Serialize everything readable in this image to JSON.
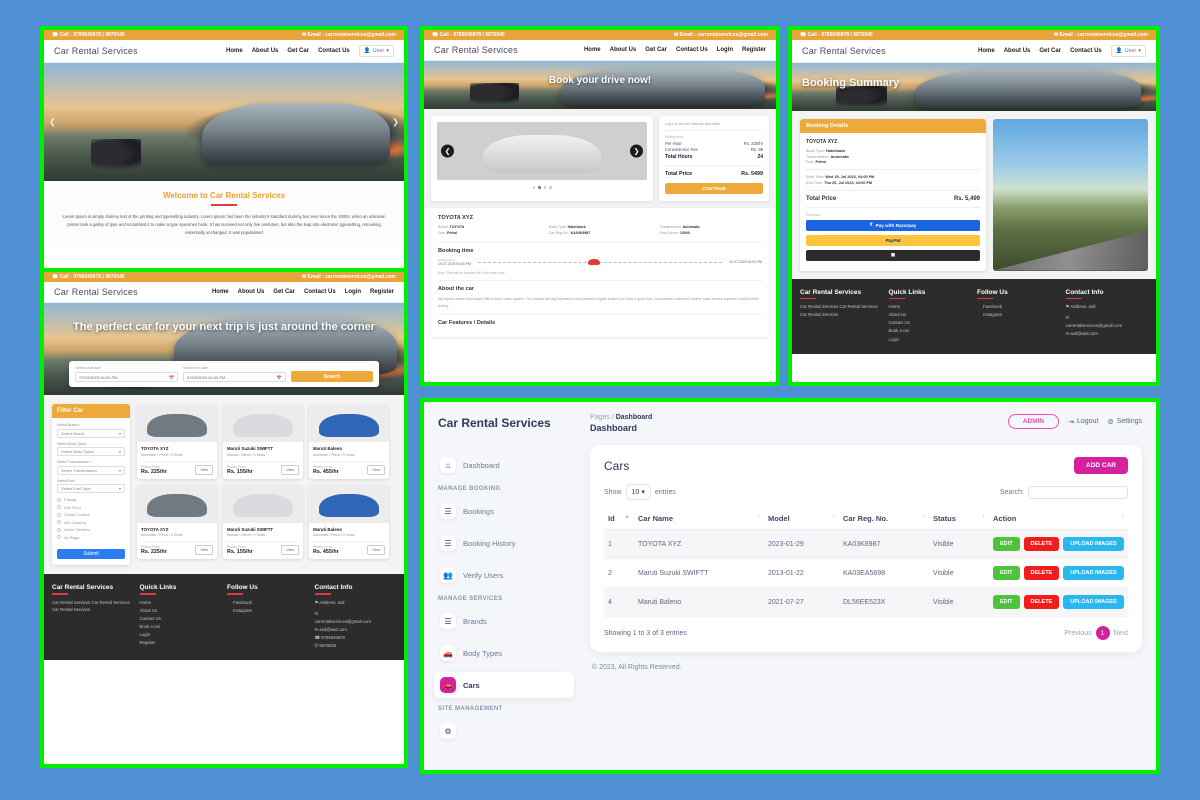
{
  "site": {
    "brand": "Car Rental Services",
    "topbar": {
      "phone": "☎ Call : 9786549878 | 9876545",
      "email": "✉ Email : carrentalservices@gmail.com"
    },
    "nav_user": [
      "Home",
      "About Us",
      "Get Car",
      "Contact Us"
    ],
    "nav_guest": [
      "Home",
      "About Us",
      "Get Car",
      "Contact Us",
      "Login",
      "Register"
    ],
    "user_menu": "User"
  },
  "home": {
    "hero_title": "",
    "welcome_title": "Welcome to Car Rental Services",
    "welcome_text": "Lorem Ipsum is simply dummy text of the printing and typesetting industry. Lorem Ipsum has been the industry's standard dummy text ever since the 1500s, when an unknown printer took a galley of type and scrambled it to make a type specimen book. It has survived not only five centuries, but also the leap into electronic typesetting, remaining essentially unchanged. It was popularised"
  },
  "search_page": {
    "hero_title": "The perfect car for your next trip is just around the corner",
    "start_label": "Select start date",
    "start_value": "07/19/2023 04:00 PM",
    "end_label": "Select end date",
    "end_value": "07/20/2023 04:00 PM",
    "search_button": "Search",
    "filter": {
      "title": "Filter Car",
      "selects": [
        {
          "label": "Select Brand *",
          "value": "Select Brand"
        },
        {
          "label": "Select Body Types",
          "value": "Select Body Types"
        },
        {
          "label": "Select Transmission *",
          "value": "Select Transmission"
        },
        {
          "label": "Select Fuel",
          "value": "Select Fuel Type"
        }
      ],
      "checkboxes": [
        "Fastag",
        "Sun Roof",
        "Cruise Control",
        "360 Camera",
        "Home Delivery",
        "Air Bags"
      ],
      "submit": "Submit"
    },
    "cars": [
      {
        "name": "TOYOTA XYZ",
        "spec": "Automatic • Petrol • 5 Seats",
        "from_label": "Pricing From",
        "price": "Rs. 225/hr",
        "view": "View",
        "color": "#6f7a82"
      },
      {
        "name": "Maruti Suzuki SWIFTT",
        "spec": "Manual • Diesel • 5 Seats",
        "from_label": "Pricing From",
        "price": "Rs. 155/hr",
        "view": "View",
        "color": "#d8dadd"
      },
      {
        "name": "Maruti Baleno",
        "spec": "Automatic • Petrol • 5 Seats",
        "from_label": "Pricing From",
        "price": "Rs. 455/hr",
        "view": "View",
        "color": "#2f66b5"
      },
      {
        "name": "TOYOTA XYZ",
        "spec": "Automatic • Petrol • 5 Seats",
        "from_label": "Pricing From",
        "price": "Rs. 225/hr",
        "view": "View",
        "color": "#6f7a82"
      },
      {
        "name": "Maruti Suzuki SWIFTT",
        "spec": "Manual • Diesel • 5 Seats",
        "from_label": "Pricing From",
        "price": "Rs. 155/hr",
        "view": "View",
        "color": "#d8dadd"
      },
      {
        "name": "Maruti Baleno",
        "spec": "Automatic • Petrol • 5 Seats",
        "from_label": "Pricing From",
        "price": "Rs. 455/hr",
        "view": "View",
        "color": "#2f66b5"
      }
    ]
  },
  "book_page": {
    "hero_title": "Book your drive now!",
    "pricing": {
      "note": "Log in to see the final fare and offers.",
      "from_label": "Pricing from",
      "rows": [
        {
          "label": "Per Hour",
          "value": "Rs. 225/hr"
        },
        {
          "label": "Convenience Fee",
          "value": "Rs. 99"
        }
      ],
      "hours_label": "Total Hours",
      "hours_value": "24",
      "total_label": "Total Price",
      "total_value": "Rs. 5499",
      "continue": "CONTINUE"
    },
    "car": {
      "name": "TOYOTA XYZ",
      "specs": [
        {
          "label": "Brand:",
          "value": "TOYOTA"
        },
        {
          "label": "Fuel:",
          "value": "Petrol"
        },
        {
          "label": "Body Type:",
          "value": "Hatchback"
        },
        {
          "label": "Car Reg.No.:",
          "value": "KA03K8987"
        },
        {
          "label": "Transmission:",
          "value": "Automatic"
        },
        {
          "label": "Kms Driven:",
          "value": "10000"
        }
      ]
    },
    "booking_time": {
      "title": "Booking time",
      "pickup_label": "Pickup Time",
      "start": "19-07-2023 04:00 PM",
      "end": "20-07-2023 04:00 PM",
      "note": "Note: Time will be rounded off to the lower hour"
    },
    "about": {
      "title": "About the car",
      "text": "My toyota comes fully loaded with a bose music system. The smooth driving Experience and powerful engine ensure you have a great ride. Comfortable cushioned leather seats ensure supreme comfort while driving.",
      "features_title": "Car Features / Details"
    }
  },
  "summary_page": {
    "hero_title": "Booking Summary",
    "details_head": "Booking Details",
    "car_name": "TOYOTA XYZ",
    "lines": [
      {
        "label": "Body Type:",
        "value": "Hatchback"
      },
      {
        "label": "Transmission:",
        "value": "Automatic"
      },
      {
        "label": "Fuel:",
        "value": "Petrol"
      }
    ],
    "times": [
      {
        "label": "Start Time:",
        "value": "Wed 19, Jul 2023, 04:00 PM"
      },
      {
        "label": "End Time:",
        "value": "Thu 20, Jul 2023, 04:00 PM"
      }
    ],
    "total_label": "Total Price",
    "total_value": "Rs. 5,499",
    "pay_now": "Pay now",
    "pay_razorpay": "Pay with Razorpay",
    "pay_paypal": "PayPal",
    "pay_card": "▤"
  },
  "footer": {
    "col1_title": "Car Rental Services",
    "col1_text": "Car Rental Services Car Rental Services Car Rental Services",
    "col2_title": "Quick Links",
    "links": [
      "Home",
      "About Us",
      "Contact Us",
      "Book a car",
      "Login",
      "Register"
    ],
    "col3_title": "Follow Us",
    "social": [
      "Facebook",
      "Instagram"
    ],
    "col4_title": "Contact Info",
    "address": "⚑ Address: asd",
    "email1": "carrentalservices@gmail.com",
    "email2": "asd@asd.com",
    "phone1": "☎ 9786549878",
    "phone2": "✆ 9876545"
  },
  "dashboard": {
    "brand": "Car Rental Services",
    "breadcrumb_pages": "Pages",
    "breadcrumb_sep": "/",
    "breadcrumb_current": "Dashboard",
    "page_title": "Dashboard",
    "admin_badge": "ADMIN",
    "logout": "Logout",
    "settings": "Settings",
    "sidebar": [
      {
        "type": "item",
        "label": "Dashboard",
        "icon": "home-icon",
        "glyph": "⌂",
        "active": false
      },
      {
        "type": "cat",
        "label": "MANAGE BOOKING"
      },
      {
        "type": "item",
        "label": "Bookings",
        "icon": "list-icon",
        "glyph": "☰",
        "active": false
      },
      {
        "type": "item",
        "label": "Booking History",
        "icon": "list-icon",
        "glyph": "☰",
        "active": false
      },
      {
        "type": "item",
        "label": "Verify Users",
        "icon": "users-icon",
        "glyph": "♟",
        "active": false
      },
      {
        "type": "cat",
        "label": "MANAGE SERVICES"
      },
      {
        "type": "item",
        "label": "Brands",
        "icon": "list-icon",
        "glyph": "☰",
        "active": false
      },
      {
        "type": "item",
        "label": "Body Types",
        "icon": "car-icon",
        "glyph": "⛟",
        "active": false
      },
      {
        "type": "item",
        "label": "Cars",
        "icon": "car-icon",
        "glyph": "⛟",
        "active": true
      },
      {
        "type": "cat",
        "label": "SITE MANAGEMENT"
      }
    ],
    "card_title": "Cars",
    "add_car": "ADD CAR",
    "show_label": "Show",
    "show_value": "10",
    "entries_label": "entries",
    "search_label": "Search:",
    "search_value": "",
    "columns": [
      "Id",
      "Car Name",
      "Model",
      "Car Reg. No.",
      "Status",
      "Action",
      ""
    ],
    "rows": [
      {
        "id": "1",
        "name": "TOYOTA XYZ",
        "model": "2023-01-29",
        "reg": "KA03K8987",
        "status": "Visible"
      },
      {
        "id": "2",
        "name": "Maruti Suzuki SWIFTT",
        "model": "2013-01-22",
        "reg": "KA03EA5698",
        "status": "Visible"
      },
      {
        "id": "4",
        "name": "Maruti Baleno",
        "model": "2021-07-27",
        "reg": "DL56EE523X",
        "status": "Visible"
      }
    ],
    "action_labels": {
      "edit": "EDIT",
      "delete": "DELETE",
      "upload": "UPLOAD IMAGES"
    },
    "showing": "Showing 1 to 3 of 3 entries",
    "pager": {
      "previous": "Previous",
      "page": "1",
      "next": "Next"
    },
    "copyright": "© 2023, All Rights Reserved."
  },
  "colors": {
    "accent_orange": "#eda93a",
    "accent_pink": "#d6219e",
    "green_border": "#00ee00",
    "page_bg": "#4f8fd4",
    "edit_green": "#4fc33c",
    "delete_red": "#f01d1d",
    "upload_blue": "#28b7ef"
  }
}
